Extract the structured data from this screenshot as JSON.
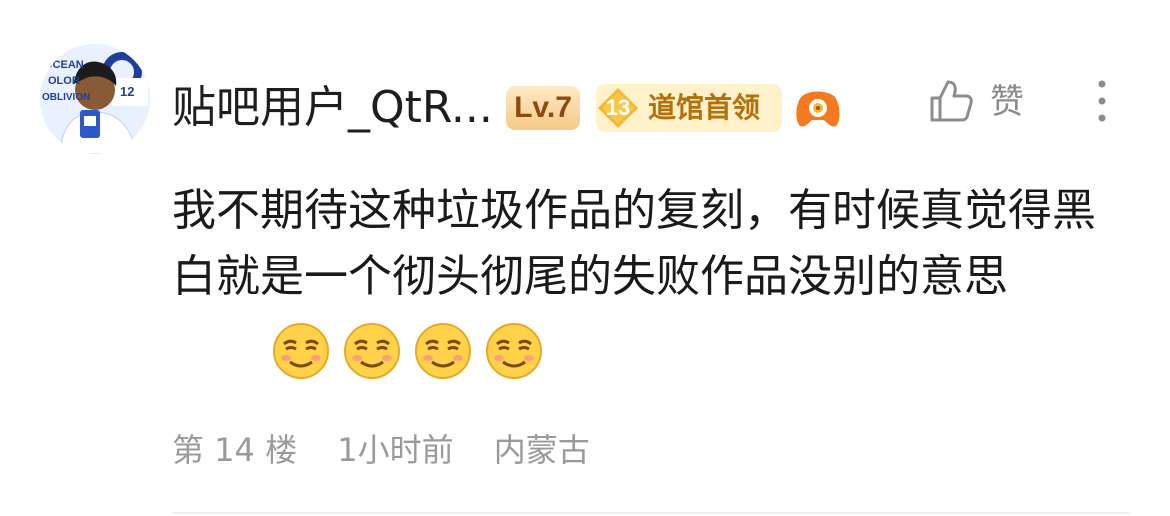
{
  "comment": {
    "username": "贴吧用户_QtR...",
    "level_badge": "Lv.7",
    "title_badge": {
      "number": "13",
      "text": "道馆首领"
    },
    "like_label": "赞",
    "content_text": "我不期待这种垃圾作品的复刻，有时候真觉得黑白就是一个彻头彻尾的失败作品没别的意思",
    "emoji_icons": [
      "smirk-emoji",
      "smirk-emoji",
      "smirk-emoji",
      "smirk-emoji"
    ],
    "floor": "第 14 楼",
    "time": "1小时前",
    "location": "内蒙古"
  },
  "avatar": {
    "text_lines": [
      "OCEAN",
      "OLOR",
      "OBLIVION"
    ],
    "badge_number": "12"
  },
  "colors": {
    "level_badge_text": "#8a4c10",
    "title_badge_bg": "#fff1c9",
    "title_badge_text": "#b5700c",
    "meta_text": "#9a9a9a",
    "icon_gray": "#8c8c8c"
  }
}
